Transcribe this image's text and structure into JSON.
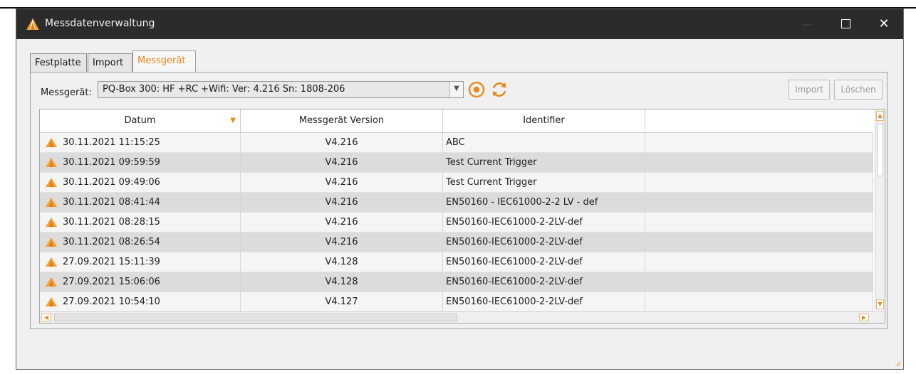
{
  "window": {
    "title": "Messdatenverwaltung",
    "close_glyph": "✕"
  },
  "tabs": [
    {
      "label": "Festplatte",
      "active": false
    },
    {
      "label": "Import",
      "active": false
    },
    {
      "label": "Messgerät",
      "active": true
    }
  ],
  "device_bar": {
    "label": "Messgerät:",
    "selected_device": "PQ-Box 300: HF +RC +Wifi: Ver: 4.216 Sn: 1808-206",
    "import_label": "Import",
    "delete_label": "Löschen"
  },
  "table": {
    "columns": [
      "Datum",
      "Messgerät Version",
      "Identifier",
      ""
    ],
    "rows": [
      {
        "datum": "30.11.2021 11:15:25",
        "version": "V4.216",
        "identifier": "ABC"
      },
      {
        "datum": "30.11.2021 09:59:59",
        "version": "V4.216",
        "identifier": "Test Current Trigger"
      },
      {
        "datum": "30.11.2021 09:49:06",
        "version": "V4.216",
        "identifier": "Test Current Trigger"
      },
      {
        "datum": "30.11.2021 08:41:44",
        "version": "V4.216",
        "identifier": "EN50160 - IEC61000-2-2 LV - def"
      },
      {
        "datum": "30.11.2021 08:28:15",
        "version": "V4.216",
        "identifier": "EN50160-IEC61000-2-2LV-def"
      },
      {
        "datum": "30.11.2021 08:26:54",
        "version": "V4.216",
        "identifier": "EN50160-IEC61000-2-2LV-def"
      },
      {
        "datum": "27.09.2021 15:11:39",
        "version": "V4.128",
        "identifier": "EN50160-IEC61000-2-2LV-def"
      },
      {
        "datum": "27.09.2021 15:06:06",
        "version": "V4.128",
        "identifier": "EN50160-IEC61000-2-2LV-def"
      },
      {
        "datum": "27.09.2021 10:54:10",
        "version": "V4.127",
        "identifier": "EN50160-IEC61000-2-2LV-def"
      }
    ]
  },
  "colors": {
    "accent": "#e8891a",
    "titlebar": "#2b2b2b",
    "row_alt": "#dcdcdc"
  },
  "icons": {
    "app": "app-logo-icon",
    "row": "measurement-file-icon",
    "record": "record-icon",
    "refresh": "refresh-icon"
  }
}
